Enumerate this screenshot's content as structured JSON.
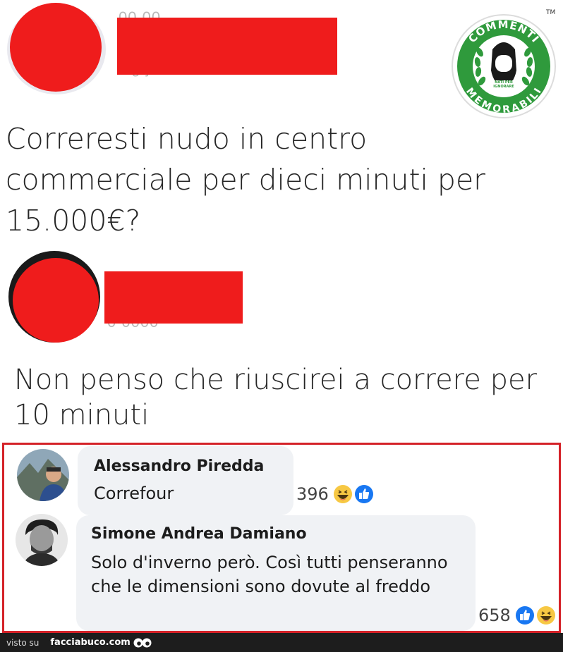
{
  "post1": {
    "author_redacted": true,
    "text": "Correresti nudo in centro commerciale per dieci minuti per 15.000€?"
  },
  "post2": {
    "author_redacted": true,
    "text": "Non penso che riuscirei a correre per 10 minuti"
  },
  "logo": {
    "top_text": "COMMENTI",
    "bottom_text": "MEMORABILI",
    "tagline_line1": "NATI PER",
    "tagline_line2": "IGNORARE",
    "trademark": "TM",
    "green": "#2f9a3c"
  },
  "comments": [
    {
      "name": "Alessandro Piredda",
      "text": "Correfour",
      "reaction_count": "396",
      "reaction_icons": [
        "haha-icon",
        "like-icon"
      ]
    },
    {
      "name": "Simone Andrea Damiano",
      "text": "Solo d'inverno però. Così tutti penseranno che le dimensioni sono dovute al freddo",
      "reaction_count": "658",
      "reaction_icons": [
        "like-icon",
        "haha-icon"
      ]
    }
  ],
  "footer": {
    "visto_su": "visto su",
    "brand": "facciabuco.com"
  },
  "colors": {
    "redaction": "#ef1c1c",
    "highlight_border": "#d42228",
    "like_blue": "#1877f2",
    "haha_yellow": "#f7c843"
  }
}
